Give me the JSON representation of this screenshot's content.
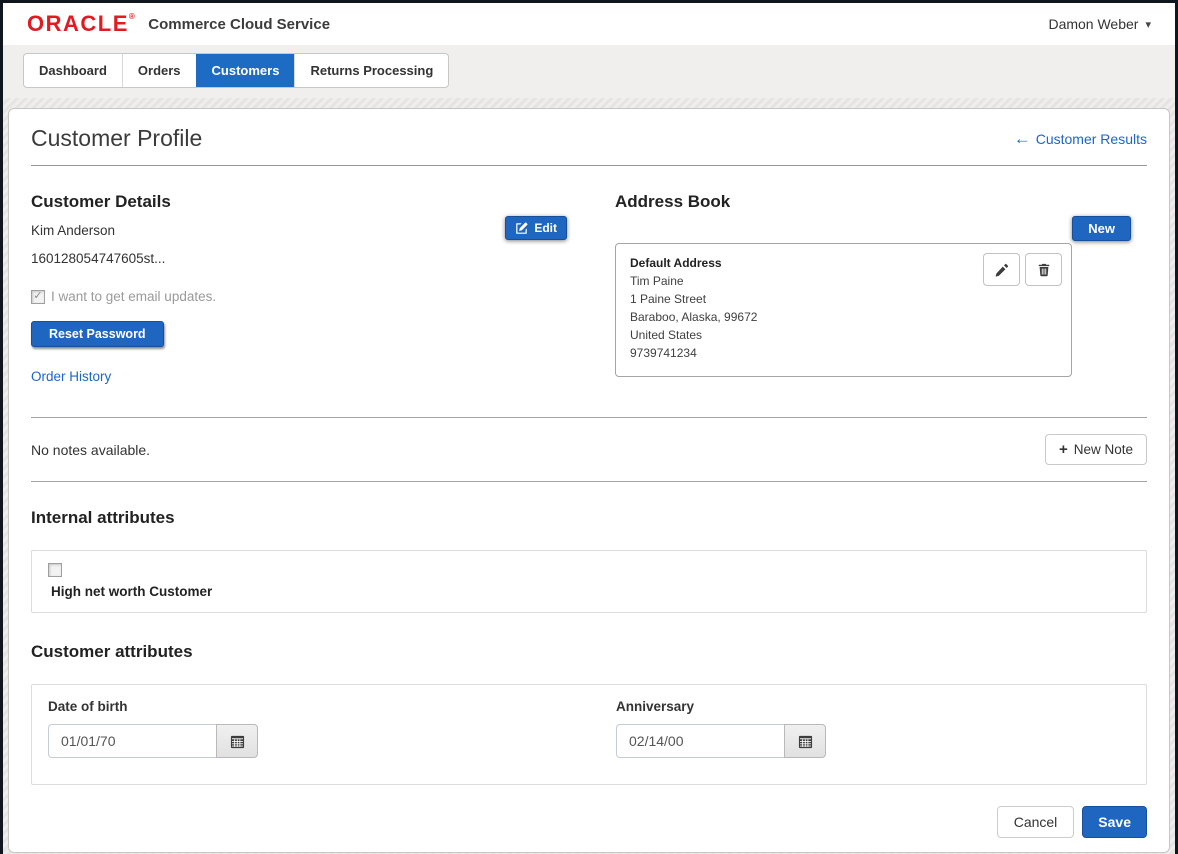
{
  "colors": {
    "oracle_red": "#e21b23",
    "primary_blue": "#1f66c1",
    "tab_active_blue": "#1e6bc4",
    "link_blue": "#1b66c9"
  },
  "header": {
    "brand": "ORACLE",
    "brand_mark": "®",
    "product": "Commerce Cloud Service",
    "user_name": "Damon Weber"
  },
  "tabs": [
    {
      "label": "Dashboard",
      "active": false
    },
    {
      "label": "Orders",
      "active": false
    },
    {
      "label": "Customers",
      "active": true
    },
    {
      "label": "Returns Processing",
      "active": false
    }
  ],
  "page": {
    "title": "Customer Profile",
    "back_link_label": "Customer Results"
  },
  "customer_details": {
    "heading": "Customer Details",
    "edit_button_label": "Edit",
    "name": "Kim Anderson",
    "login": "160128054747605st...",
    "email_optin_label": "I want to get email updates.",
    "email_optin_checked": true,
    "check_glyph": "✓",
    "reset_password_label": "Reset Password",
    "order_history_label": "Order History"
  },
  "address_book": {
    "heading": "Address Book",
    "new_button_label": "New",
    "default_address": {
      "title": "Default Address",
      "name": "Tim Paine",
      "street": "1 Paine Street",
      "city_state_zip": "Baraboo, Alaska, 99672",
      "country": "United States",
      "phone": "9739741234"
    }
  },
  "notes": {
    "empty_message": "No notes available.",
    "new_note_label": "New Note",
    "plus_glyph": "+"
  },
  "internal_attributes": {
    "heading": "Internal attributes",
    "checkbox_label": "High net worth Customer",
    "checkbox_checked": false
  },
  "customer_attributes": {
    "heading": "Customer attributes",
    "fields": [
      {
        "label": "Date of birth",
        "value": "01/01/70"
      },
      {
        "label": "Anniversary",
        "value": "02/14/00"
      }
    ]
  },
  "footer": {
    "cancel_label": "Cancel",
    "save_label": "Save"
  },
  "misc": {
    "back_arrow_glyph": "←",
    "caret_glyph": "▾"
  }
}
